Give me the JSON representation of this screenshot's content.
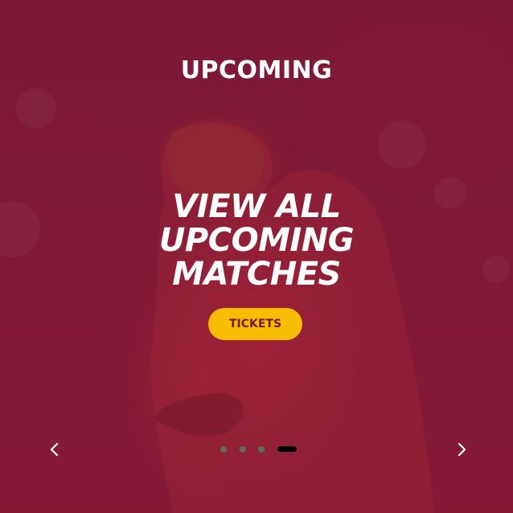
{
  "section": {
    "title": "UPCOMING"
  },
  "slide": {
    "headline_lines": [
      "VIEW ALL",
      "UPCOMING",
      "MATCHES"
    ],
    "cta_label": "TICKETS"
  },
  "carousel": {
    "total_slides": 4,
    "active_index": 3
  },
  "colors": {
    "overlay": "#7a1a36",
    "button_bg": "#f7be00",
    "button_text": "#7a1430",
    "text": "#ffffff",
    "dot_inactive": "#5e6b5e",
    "dot_active": "#000000"
  },
  "icons": {
    "prev": "chevron-left-icon",
    "next": "chevron-right-icon"
  }
}
